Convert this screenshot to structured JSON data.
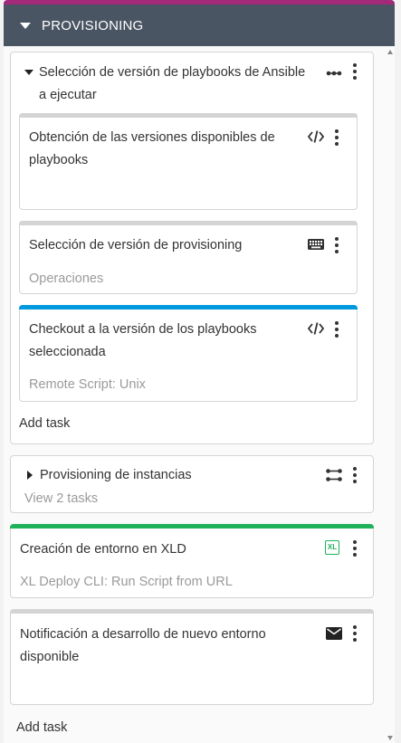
{
  "phase": {
    "title": "PROVISIONING",
    "accent_color": "#a3297a",
    "header_bg": "#4a5563"
  },
  "group1": {
    "title": "Selección de versión de playbooks de Ansible a ejecutar",
    "icon": "more-horiz-icon",
    "tasks": [
      {
        "title": "Obtención de las versiones disponibles de playbooks",
        "subtitle": "",
        "icon": "code-icon",
        "bar_color": "#d4d4d4"
      },
      {
        "title": "Selección de versión de provisioning",
        "subtitle": "Operaciones",
        "icon": "keyboard-icon",
        "bar_color": "#d4d4d4"
      },
      {
        "title": "Checkout a la versión de los playbooks seleccionada",
        "subtitle": "Remote Script: Unix",
        "icon": "code-icon",
        "bar_color": "#0099dd"
      }
    ],
    "add_task": "Add task"
  },
  "group2": {
    "title": "Provisioning de instancias",
    "subtitle": "View 2 tasks",
    "icon": "parallel-group-icon"
  },
  "task_xld": {
    "title": "Creación de entorno en XLD",
    "subtitle": "XL Deploy CLI: Run Script from URL",
    "icon": "xl-deploy-icon",
    "icon_text": "XL",
    "bar_color": "#1fb25a"
  },
  "task_notify": {
    "title": "Notificación a desarrollo de nuevo entorno disponible",
    "subtitle": "",
    "icon": "mail-icon",
    "bar_color": "#d4d4d4"
  },
  "add_task_bottom": "Add task"
}
